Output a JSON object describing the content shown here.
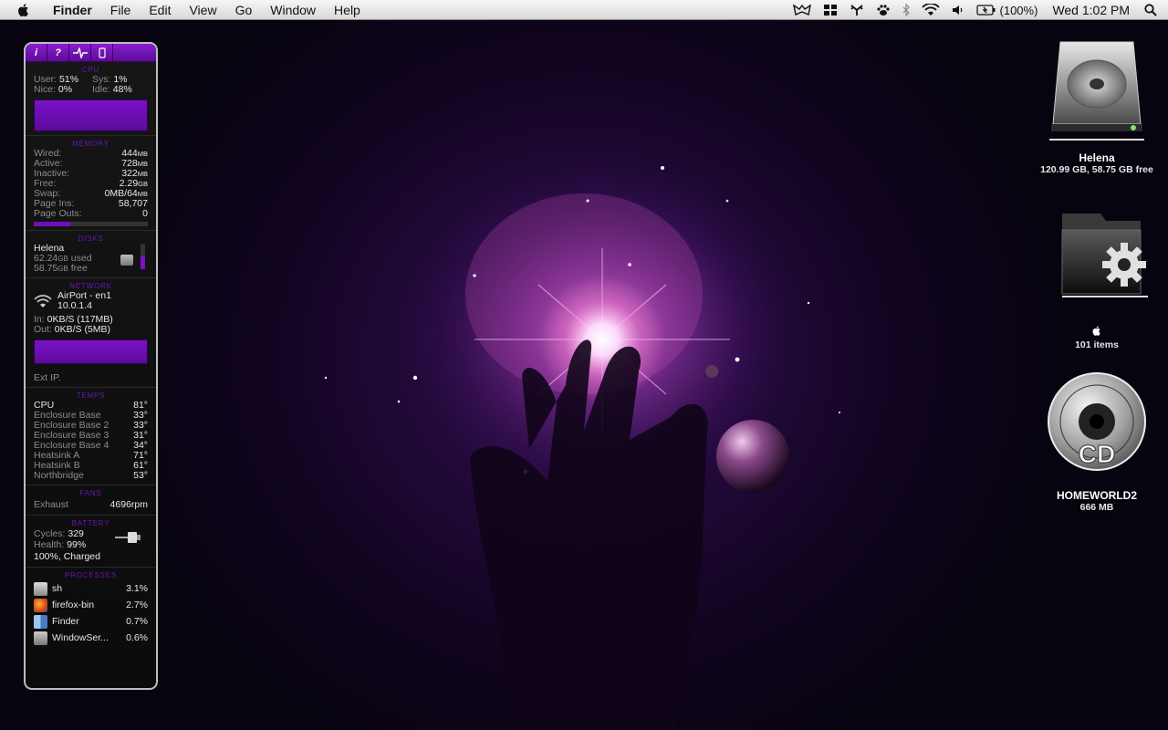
{
  "menubar": {
    "app_name": "Finder",
    "menus": [
      "File",
      "Edit",
      "View",
      "Go",
      "Window",
      "Help"
    ],
    "status_icons": [
      "growl-icon",
      "spaces-icon",
      "antler-icon",
      "paw-icon",
      "bluetooth-icon",
      "wifi-icon",
      "volume-icon"
    ],
    "battery_text": "(100%)",
    "clock": "Wed 1:02 PM"
  },
  "widget": {
    "tabs": [
      "i",
      "?",
      "pulse-icon",
      "phone-icon"
    ],
    "cpu": {
      "title": "CPU",
      "user_label": "User:",
      "user_value": "51%",
      "sys_label": "Sys:",
      "sys_value": "1%",
      "nice_label": "Nice:",
      "nice_value": "0%",
      "idle_label": "Idle:",
      "idle_value": "48%"
    },
    "memory": {
      "title": "MEMORY",
      "rows": [
        {
          "label": "Wired:",
          "value": "444",
          "unit": "MB"
        },
        {
          "label": "Active:",
          "value": "728",
          "unit": "MB"
        },
        {
          "label": "Inactive:",
          "value": "322",
          "unit": "MB"
        },
        {
          "label": "Free:",
          "value": "2.29",
          "unit": "GB"
        },
        {
          "label": "Swap:",
          "value": "0MB/64",
          "unit": "MB"
        },
        {
          "label": "Page Ins:",
          "value": "58,707",
          "unit": ""
        },
        {
          "label": "Page Outs:",
          "value": "0",
          "unit": ""
        }
      ],
      "usage_fraction": 0.32
    },
    "disks": {
      "title": "DISKS",
      "name": "Helena",
      "used_value": "62.24",
      "used_unit": "GB",
      "used_suffix": "used",
      "free_value": "58.75",
      "free_unit": "GB",
      "free_suffix": "free",
      "used_fraction": 0.51
    },
    "network": {
      "title": "NETWORK",
      "interface": "AirPort - en1",
      "ip": "10.0.1.4",
      "in_label": "In:",
      "in_value": "0KB/S (117MB)",
      "out_label": "Out:",
      "out_value": "0KB/S (5MB)",
      "ext_ip_label": "Ext IP."
    },
    "temps": {
      "title": "TEMPS",
      "rows": [
        {
          "label": "CPU",
          "value": "81°"
        },
        {
          "label": "Enclosure Base",
          "value": "33°"
        },
        {
          "label": "Enclosure Base 2",
          "value": "33°"
        },
        {
          "label": "Enclosure Base 3",
          "value": "31°"
        },
        {
          "label": "Enclosure Base 4",
          "value": "34°"
        },
        {
          "label": "Heatsink A",
          "value": "71°"
        },
        {
          "label": "Heatsink B",
          "value": "61°"
        },
        {
          "label": "Northbridge",
          "value": "53°"
        }
      ]
    },
    "fans": {
      "title": "FANS",
      "label": "Exhaust",
      "value": "4696rpm"
    },
    "battery": {
      "title": "BATTERY",
      "cycles_label": "Cycles:",
      "cycles_value": "329",
      "health_label": "Health:",
      "health_value": "99%",
      "status": "100%, Charged"
    },
    "processes": {
      "title": "PROCESSES",
      "rows": [
        {
          "name": "sh",
          "value": "3.1%",
          "icon": "script-icon"
        },
        {
          "name": "firefox-bin",
          "value": "2.7%",
          "icon": "firefox-icon"
        },
        {
          "name": "Finder",
          "value": "0.7%",
          "icon": "finder-icon"
        },
        {
          "name": "WindowSer...",
          "value": "0.6%",
          "icon": "app-icon"
        }
      ]
    }
  },
  "desktop": {
    "hd": {
      "name": "Helena",
      "info": "120.99 GB, 58.75 GB free"
    },
    "folder": {
      "name": "",
      "info": "101 items"
    },
    "cd": {
      "name": "HOMEWORLD2",
      "info": "666 MB",
      "badge": "CD"
    }
  },
  "colors": {
    "accent": "#6a14b4",
    "bar": "#6e10b8",
    "wallpaper_core": "#ffffff"
  }
}
